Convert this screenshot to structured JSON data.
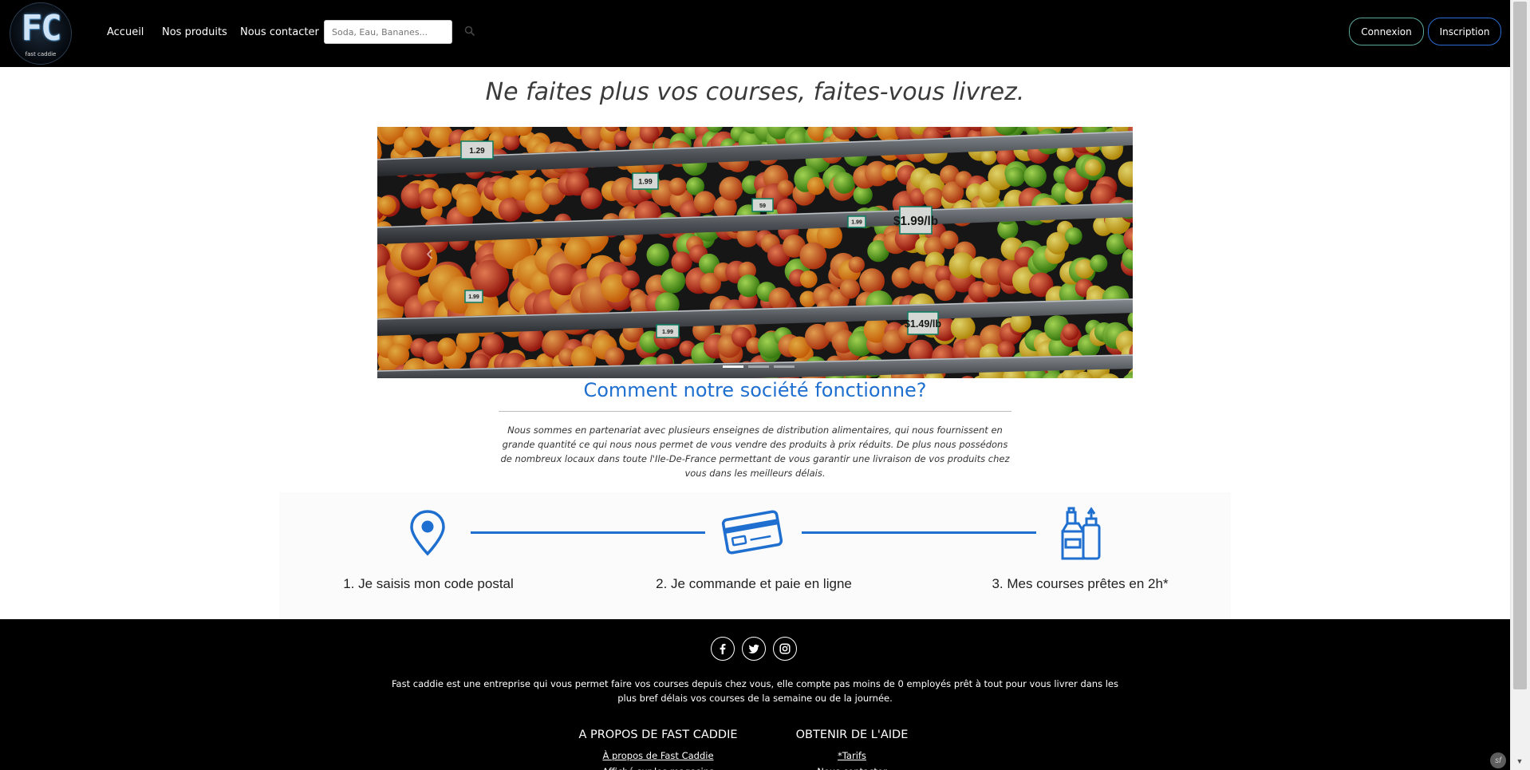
{
  "brand": {
    "logo_letters": "FC",
    "logo_tagline": "fast caddie"
  },
  "nav": {
    "links": [
      "Accueil",
      "Nos produits",
      "Nous contacter"
    ],
    "search_placeholder": "Soda, Eau, Bananes...",
    "login_label": "Connexion",
    "signup_label": "Inscription"
  },
  "hero": {
    "tagline": "Ne faites plus vos courses, faites-vous livrez.",
    "carousel": {
      "slide_count": 3,
      "active_slide": 1,
      "price_tags": [
        "1.29",
        "1.99",
        "59",
        "1.99",
        "1.99",
        "1.99",
        "$1.99/lb",
        "$1.49/lb"
      ]
    }
  },
  "how": {
    "title": "Comment notre société fonctionne?",
    "text": "Nous sommes en partenariat avec plusieurs enseignes de distribution alimentaires, qui nous fournissent en grande quantité ce qui nous nous permet de vous vendre des produits à prix réduits. De plus nous possédons de nombreux locaux dans toute l'Ile-De-France permettant de vous garantir une livraison de vos produits chez vous dans les meilleurs délais.",
    "steps": [
      {
        "label": "1. Je saisis mon code postal",
        "icon": "map-pin-icon"
      },
      {
        "label": "2. Je commande et paie en ligne",
        "icon": "credit-card-icon"
      },
      {
        "label": "3. Mes courses prêtes en 2h*",
        "icon": "grocery-bag-icon"
      }
    ],
    "accent_color": "#1e6fcf"
  },
  "footer": {
    "social": [
      "facebook-icon",
      "twitter-icon",
      "instagram-icon"
    ],
    "text": "Fast caddie est une entreprise qui vous permet faire vos courses depuis chez vous, elle compte pas moins de 0 employés prêt à tout pour vous livrer dans les plus bref délais vos courses de la semaine ou de la journée.",
    "columns": [
      {
        "title": "A PROPOS DE FAST CADDIE",
        "link": "À propos de Fast Caddie",
        "next": "Affiché sur les magasins"
      },
      {
        "title": "OBTENIR DE L'AIDE",
        "link": "*Tarifs",
        "next": "Nous contacter"
      }
    ]
  }
}
